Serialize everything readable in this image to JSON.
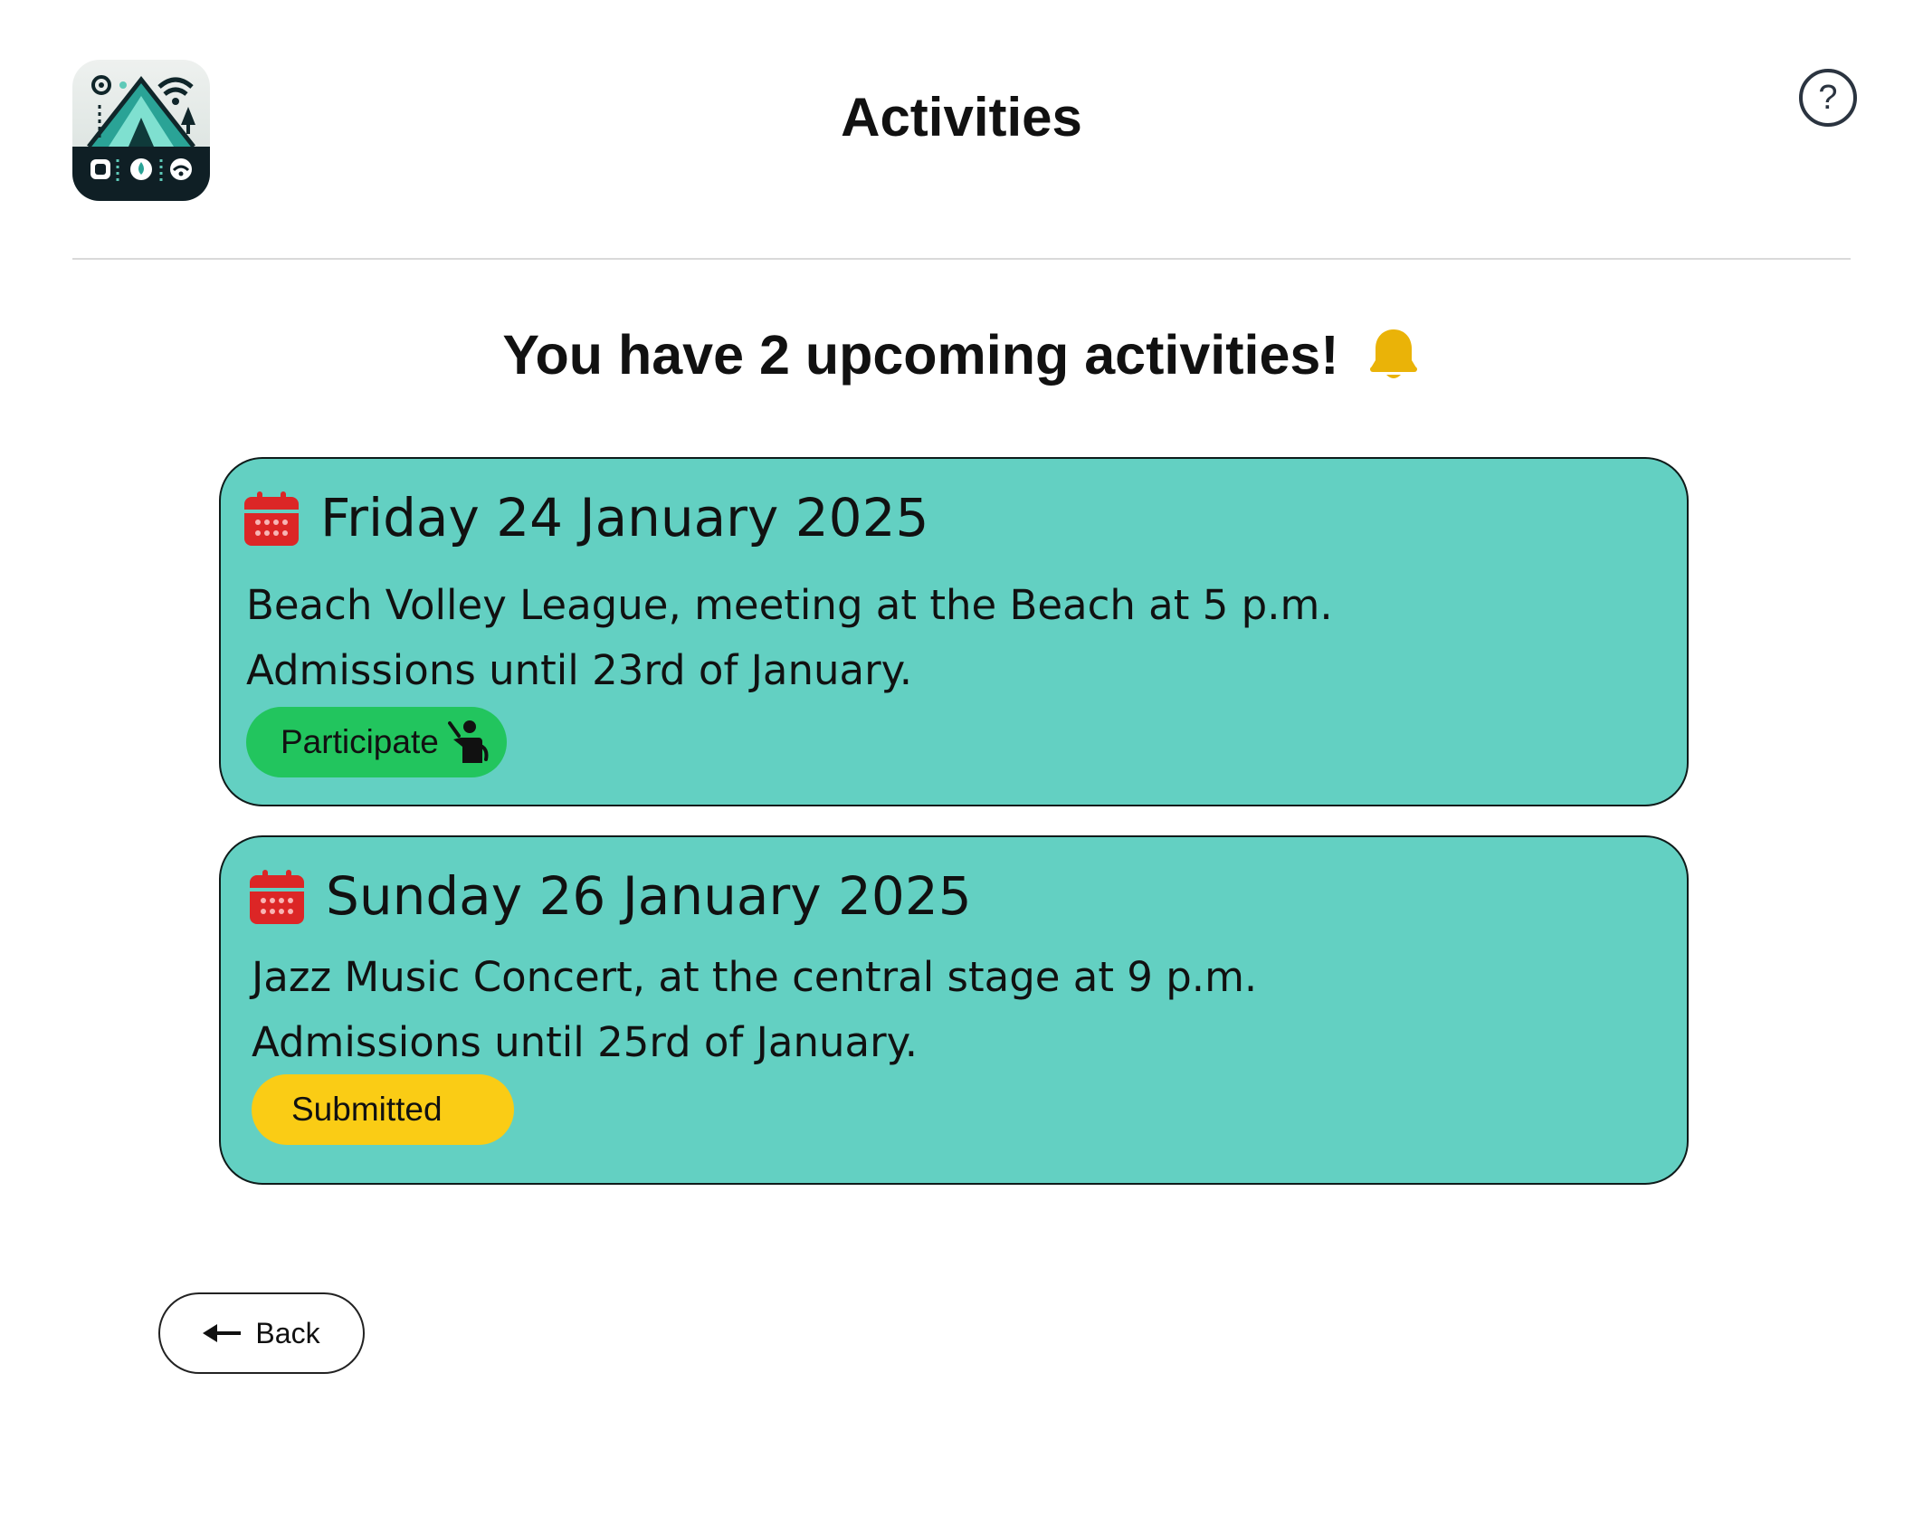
{
  "app": {
    "logo_icon": "camping-tent-logo-icon"
  },
  "header": {
    "title": "Activities",
    "help_label": "?",
    "help_icon": "help-icon"
  },
  "summary": {
    "text": "You have 2 upcoming activities!",
    "icon": "bell-icon",
    "icon_color": "#eab308"
  },
  "activities": [
    {
      "date": "Friday 24 January 2025",
      "line1": "Beach Volley League, meeting at the Beach at 5 p.m.",
      "line2": "Admissions until 23rd of January.",
      "action_label": "Participate",
      "action_icon": "raised-hand-icon",
      "action_color": "#22c55e"
    },
    {
      "date": "Sunday 26 January 2025",
      "line1": "Jazz Music Concert, at the central stage at 9 p.m.",
      "line2": "Admissions until 25rd of January.",
      "status_label": "Submitted",
      "status_color": "#facc15"
    }
  ],
  "footer": {
    "back_label": "Back",
    "back_icon": "arrow-left-icon"
  },
  "colors": {
    "card_background": "#63d0c2",
    "calendar_icon": "#dc2626",
    "text": "#111111"
  }
}
